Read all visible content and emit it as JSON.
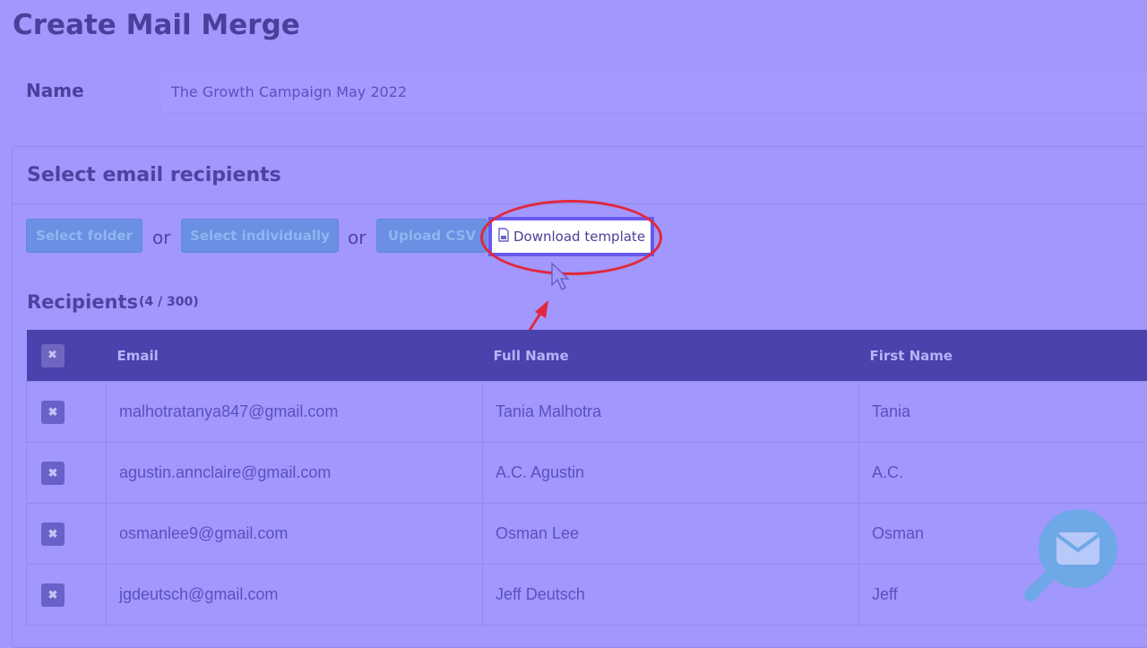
{
  "page": {
    "title": "Create Mail Merge",
    "name_label": "Name",
    "name_value": "The Growth Campaign May 2022"
  },
  "recipients_section": {
    "title": "Select email recipients",
    "buttons": {
      "select_folder": "Select folder",
      "select_individually": "Select individually",
      "upload_csv": "Upload CSV",
      "download_template": "Download template"
    },
    "or_text": "or",
    "list_title": "Recipients",
    "count": "(4 / 300)"
  },
  "table": {
    "remove_all_icon": "✖",
    "columns": [
      "Email",
      "Full Name",
      "First Name"
    ],
    "rows": [
      {
        "email": "malhotratanya847@gmail.com",
        "full_name": "Tania Malhotra",
        "first_name": "Tania"
      },
      {
        "email": "agustin.annclaire@gmail.com",
        "full_name": "A.C. Agustin",
        "first_name": "A.C."
      },
      {
        "email": "osmanlee9@gmail.com",
        "full_name": "Osman Lee",
        "first_name": "Osman"
      },
      {
        "email": "jgdeutsch@gmail.com",
        "full_name": "Jeff Deutsch",
        "first_name": "Jeff"
      }
    ]
  },
  "icons": {
    "remove": "close-icon",
    "document": "file-icon",
    "cursor": "mouse-pointer-icon",
    "logo": "envelope-search-icon"
  },
  "colors": {
    "background": "#a297fd",
    "header": "#4a42ad",
    "button": "#6b8fe3",
    "highlight": "#e0283d"
  }
}
